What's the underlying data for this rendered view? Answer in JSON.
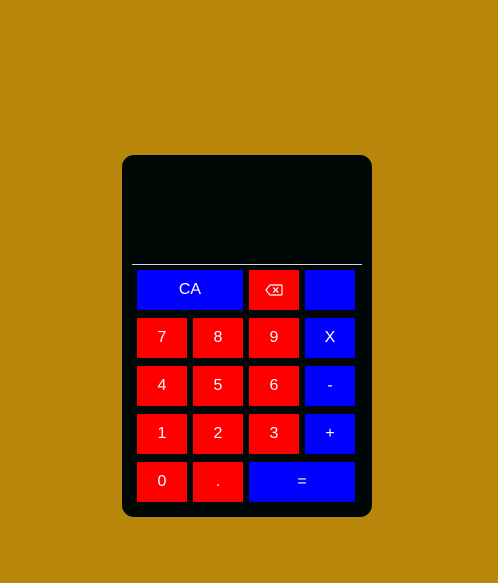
{
  "display": {
    "value": ""
  },
  "keys": {
    "clear_all": "CA",
    "backspace_icon": "backspace-icon",
    "divide": "",
    "seven": "7",
    "eight": "8",
    "nine": "9",
    "multiply": "X",
    "four": "4",
    "five": "5",
    "six": "6",
    "minus": "-",
    "one": "1",
    "two": "2",
    "three": "3",
    "plus": "+",
    "zero": "0",
    "decimal": ".",
    "equals": "="
  },
  "colors": {
    "page_background": "#b8860b",
    "calculator_body": "#000807",
    "digit_key": "#ff0000",
    "operator_key": "#0000ff",
    "key_text": "#ffffff"
  }
}
